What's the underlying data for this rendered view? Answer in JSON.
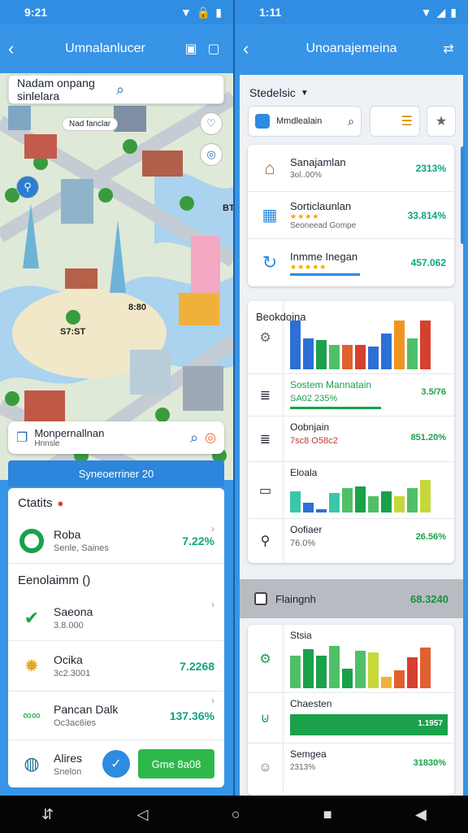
{
  "status_left": {
    "time": "9:21"
  },
  "status_right": {
    "time": "1:11"
  },
  "left": {
    "appbar_title": "Umnalanlucer",
    "search_placeholder": "Nadam onpang sinlelara",
    "map_chip": "Nad fanclar",
    "map_labels": [
      "8:80",
      "S7:ST",
      "BT"
    ],
    "location": {
      "title": "Monpernallnan",
      "subtitle": "Hnnsle"
    },
    "banner": "Syneoerriner 20",
    "stats_title": "Ctatits",
    "stats_row": {
      "title": "Roba",
      "subtitle": "Senle, Saines",
      "value": "7.22%"
    },
    "section2_title": "Eenolaimm ()",
    "rows": [
      {
        "title": "Saeona",
        "subtitle": "3.8.000",
        "value": ""
      },
      {
        "title": "Ocika",
        "subtitle": "3c2.3001",
        "value": "7.2268"
      },
      {
        "title": "Pancan Dalk",
        "subtitle": "Oc3ac6ies",
        "value": "137.36%"
      }
    ],
    "bottom": {
      "title": "Alires",
      "subtitle": "Snelon",
      "button": "Gme 8a08"
    }
  },
  "right": {
    "appbar_title": "Unoanajemeina",
    "filter_label": "Stedelsic",
    "search_placeholder": "Mmdlealain",
    "top_rows": [
      {
        "title": "Sanajamlan",
        "subtitle": "3ol..00%",
        "value": "2313%"
      },
      {
        "title": "Sorticlaunlan",
        "subtitle": "Seoneead Gompe",
        "value": "33.814%"
      },
      {
        "title": "Inmme Inegan",
        "subtitle": "",
        "value": "457.062"
      }
    ],
    "chart_title": "Beokdoina",
    "chart_rows": [
      {
        "title": "Sostem Mannatain",
        "subtitle": "SA02 235%",
        "value": "3.5/76"
      },
      {
        "title": "Oobnjain",
        "subtitle": "7sc8 O58c2",
        "value": "851.20%"
      },
      {
        "title": "Eloala",
        "subtitle": "",
        "value": ""
      },
      {
        "title": "Oofiaer",
        "subtitle": "76.0%",
        "value": "26.56%"
      }
    ],
    "highlight": {
      "title": "Flaingnh",
      "value": "68.3240"
    },
    "lower": {
      "chart_title": "Stsia",
      "rows": [
        {
          "title": "Chaesten",
          "value": "1.1957"
        },
        {
          "title": "Semgea",
          "subtitle": "2313%",
          "value": "31830%"
        }
      ]
    }
  },
  "colors": {
    "accent": "#3794e6",
    "green": "#10a37f",
    "button": "#2eb84c"
  }
}
